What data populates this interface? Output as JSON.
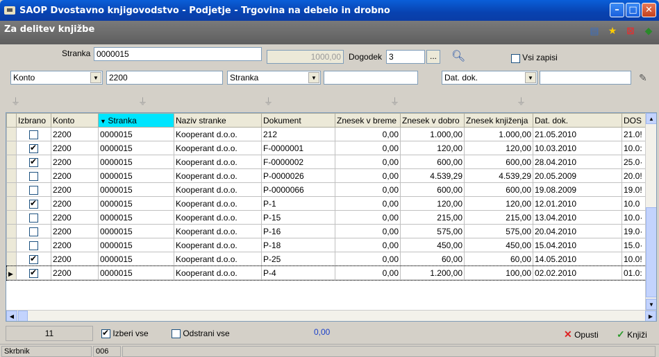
{
  "window": {
    "title": "SAOP Dvostavno knjigovodstvo  - Podjetje - Trgovina na debelo in drobno"
  },
  "subtitle": "Za delitev knjižbe",
  "filters": {
    "stranka_label": "Stranka",
    "stranka_value": "0000015",
    "amount_value": "1000,00",
    "dogodek_label": "Dogodek",
    "dogodek_value": "3",
    "ellipsis": "...",
    "vsi_zapisi_label": "Vsi zapisi",
    "field1": "Konto",
    "field1_value": "2200",
    "field2": "Stranka",
    "field2_value": "",
    "field3": "Dat. dok.",
    "field3_value": ""
  },
  "table": {
    "headers": [
      "Izbrano",
      "Konto",
      "Stranka",
      "Naziv stranke",
      "Dokument",
      "Znesek v breme",
      "Znesek v dobro",
      "Znesek knjiženja",
      "Dat. dok.",
      "DOS"
    ],
    "rows": [
      {
        "checked": false,
        "konto": "2200",
        "stranka": "0000015",
        "naziv": "Kooperant d.o.o.",
        "dokument": "212",
        "breme": "0,00",
        "dobro": "1.000,00",
        "knjizenja": "1.000,00",
        "datum": "21.05.2010",
        "dos": "21.0!"
      },
      {
        "checked": true,
        "konto": "2200",
        "stranka": "0000015",
        "naziv": "Kooperant d.o.o.",
        "dokument": "F-0000001",
        "breme": "0,00",
        "dobro": "120,00",
        "knjizenja": "120,00",
        "datum": "10.03.2010",
        "dos": "10.0:"
      },
      {
        "checked": true,
        "konto": "2200",
        "stranka": "0000015",
        "naziv": "Kooperant d.o.o.",
        "dokument": "F-0000002",
        "breme": "0,00",
        "dobro": "600,00",
        "knjizenja": "600,00",
        "datum": "28.04.2010",
        "dos": "25.0·"
      },
      {
        "checked": false,
        "konto": "2200",
        "stranka": "0000015",
        "naziv": "Kooperant d.o.o.",
        "dokument": "P-0000026",
        "breme": "0,00",
        "dobro": "4.539,29",
        "knjizenja": "4.539,29",
        "datum": "20.05.2009",
        "dos": "20.0!"
      },
      {
        "checked": false,
        "konto": "2200",
        "stranka": "0000015",
        "naziv": "Kooperant d.o.o.",
        "dokument": "P-0000066",
        "breme": "0,00",
        "dobro": "600,00",
        "knjizenja": "600,00",
        "datum": "19.08.2009",
        "dos": "19.0!"
      },
      {
        "checked": true,
        "konto": "2200",
        "stranka": "0000015",
        "naziv": "Kooperant d.o.o.",
        "dokument": "P-1",
        "breme": "0,00",
        "dobro": "120,00",
        "knjizenja": "120,00",
        "datum": "12.01.2010",
        "dos": "10.0"
      },
      {
        "checked": false,
        "konto": "2200",
        "stranka": "0000015",
        "naziv": "Kooperant d.o.o.",
        "dokument": "P-15",
        "breme": "0,00",
        "dobro": "215,00",
        "knjizenja": "215,00",
        "datum": "13.04.2010",
        "dos": "10.0·"
      },
      {
        "checked": false,
        "konto": "2200",
        "stranka": "0000015",
        "naziv": "Kooperant d.o.o.",
        "dokument": "P-16",
        "breme": "0,00",
        "dobro": "575,00",
        "knjizenja": "575,00",
        "datum": "20.04.2010",
        "dos": "19.0·"
      },
      {
        "checked": false,
        "konto": "2200",
        "stranka": "0000015",
        "naziv": "Kooperant d.o.o.",
        "dokument": "P-18",
        "breme": "0,00",
        "dobro": "450,00",
        "knjizenja": "450,00",
        "datum": "15.04.2010",
        "dos": "15.0·"
      },
      {
        "checked": true,
        "konto": "2200",
        "stranka": "0000015",
        "naziv": "Kooperant d.o.o.",
        "dokument": "P-25",
        "breme": "0,00",
        "dobro": "60,00",
        "knjizenja": "60,00",
        "datum": "14.05.2010",
        "dos": "10.0!"
      },
      {
        "checked": true,
        "konto": "2200",
        "stranka": "0000015",
        "naziv": "Kooperant d.o.o.",
        "dokument": "P-4",
        "breme": "0,00",
        "dobro": "1.200,00",
        "knjizenja": "100,00",
        "datum": "02.02.2010",
        "dos": "01.0:"
      }
    ]
  },
  "footer": {
    "count": "11",
    "select_all": "Izberi vse",
    "remove_all": "Odstrani vse",
    "total": "0,00",
    "cancel": "Opusti",
    "post": "Knjiži"
  },
  "status": {
    "user": "Skrbnik",
    "code": "006"
  }
}
